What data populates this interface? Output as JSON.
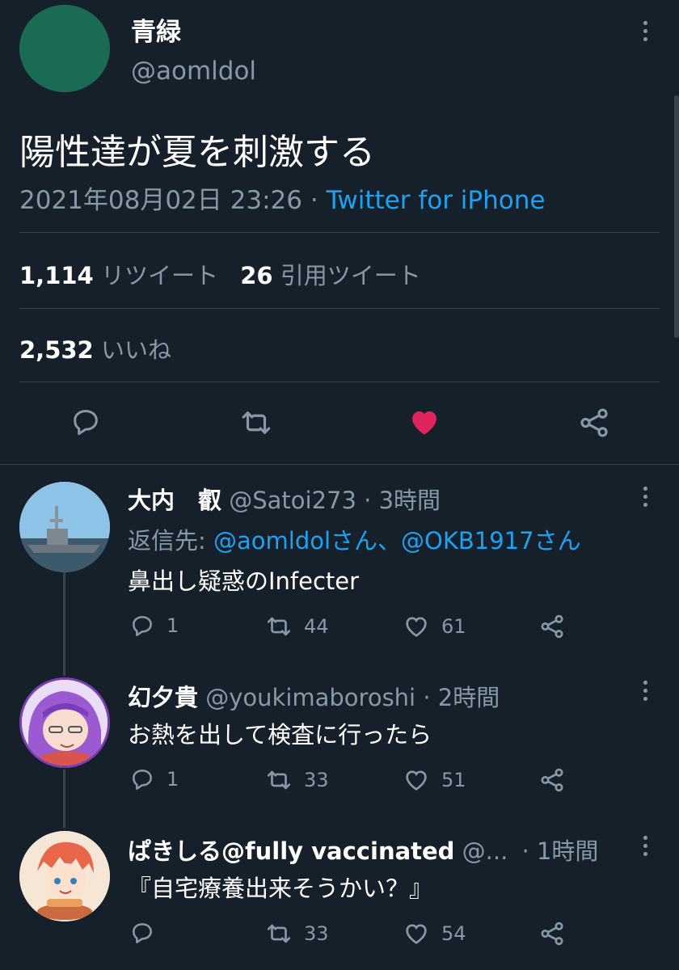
{
  "colors": {
    "background": "#15202b",
    "accent": "#1da1f2",
    "like": "#e0245e",
    "muted": "#8899a6",
    "divider": "#38444d"
  },
  "tweet": {
    "author_name": "青緑",
    "handle": "@aomldol",
    "text": "陽性達が夏を刺激する",
    "timestamp": "2021年08月02日 23:26",
    "separator": "·",
    "source": "Twitter for iPhone",
    "retweets": {
      "count": "1,114",
      "label": "リツイート"
    },
    "quotes": {
      "count": "26",
      "label": "引用ツイート"
    },
    "likes": {
      "count": "2,532",
      "label": "いいね"
    },
    "liked": true,
    "actions": [
      "reply-icon",
      "retweet-icon",
      "heart-filled-icon",
      "share-icon"
    ]
  },
  "replies": [
    {
      "name": "大内　叡",
      "handle": "@Satoi273",
      "sep": "·",
      "time": "3時間",
      "reply_to_label": "返信先:",
      "reply_to_users": "@aomldolさん、@OKB1917さん",
      "text": "鼻出し疑惑のInfecter",
      "reply_count": "1",
      "retweet_count": "44",
      "like_count": "61"
    },
    {
      "name": "幻夕貴",
      "handle": "@youkimaboroshi",
      "sep": "·",
      "time": "2時間",
      "text": "お熱を出して検査に行ったら",
      "reply_count": "1",
      "retweet_count": "33",
      "like_count": "51"
    },
    {
      "name": "ぱきしる@fully vaccinated",
      "handle": "@...",
      "sep": "·",
      "time": "1時間",
      "text": "『自宅療養出来そうかい？』",
      "reply_count": "",
      "retweet_count": "33",
      "like_count": "54"
    }
  ]
}
